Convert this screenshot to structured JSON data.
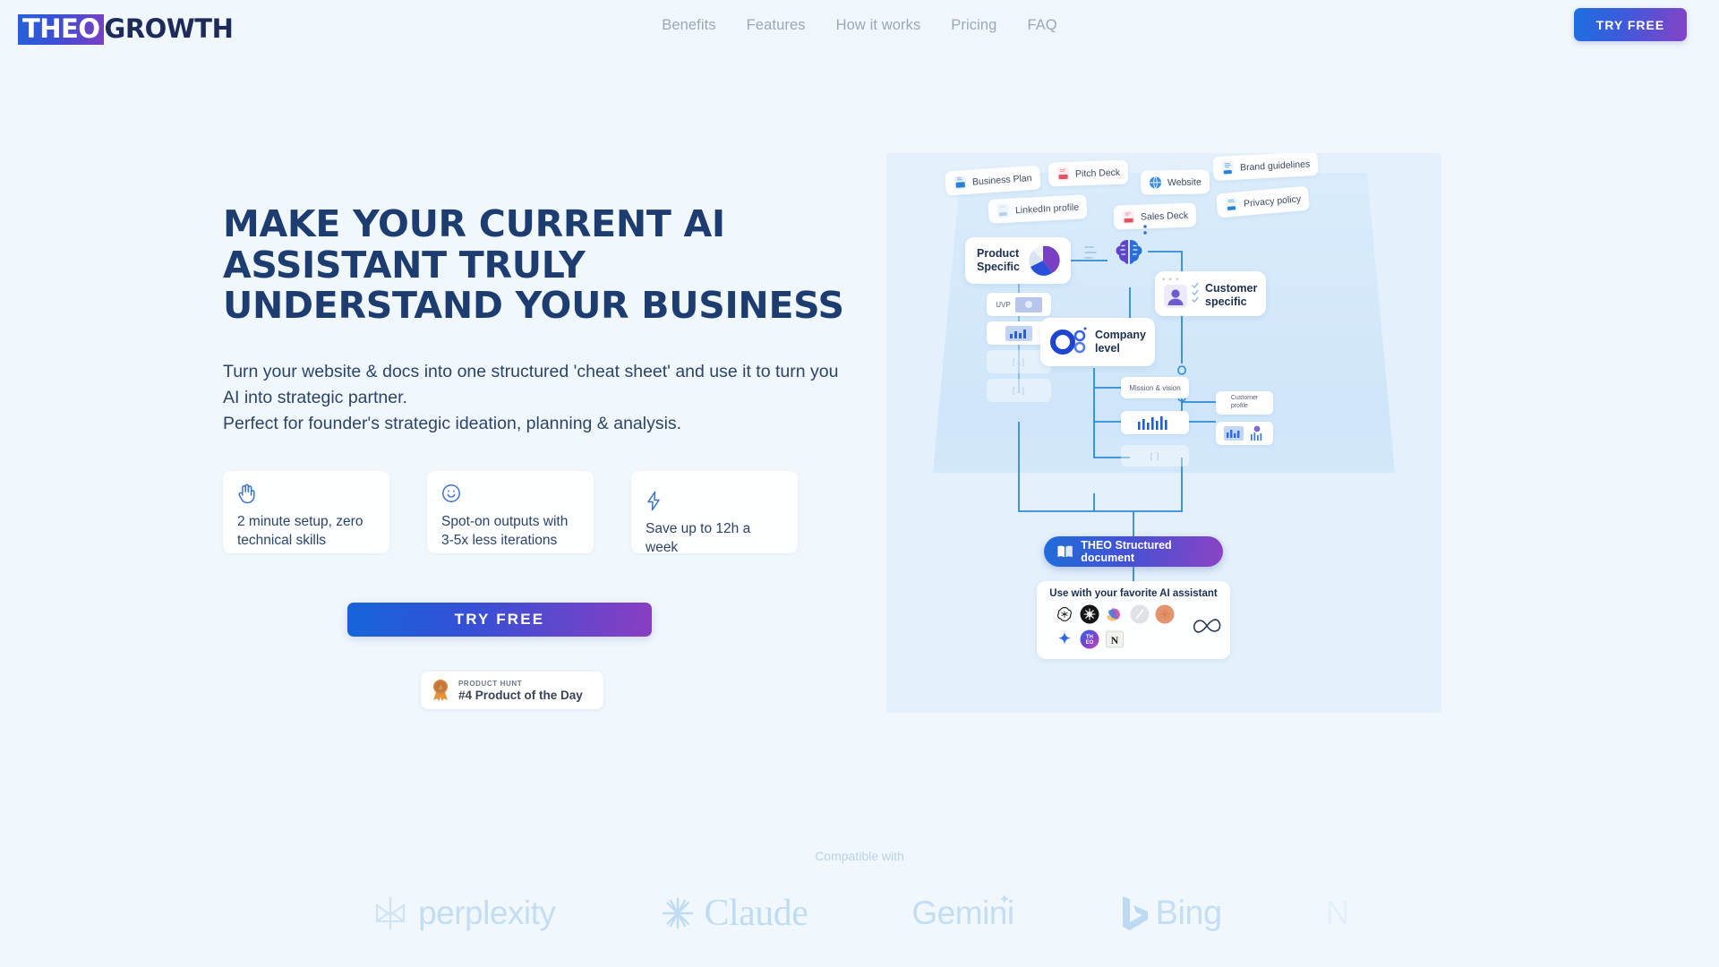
{
  "brand": {
    "logo_primary": "THEO",
    "logo_secondary": "GROWTH",
    "accent_blue": "#1d6fe0",
    "accent_purple": "#8642c6",
    "headline_color": "#1d3c70",
    "page_background": "#f1f8fd",
    "panel_background": "#e4f1fc"
  },
  "header": {
    "nav": [
      {
        "label": "Benefits"
      },
      {
        "label": "Features"
      },
      {
        "label": "How it works"
      },
      {
        "label": "Pricing"
      },
      {
        "label": "FAQ"
      }
    ],
    "cta_label": "TRY FREE"
  },
  "hero": {
    "headline": "Make your current AI assistant truly understand your business",
    "subtext_line1": "Turn your website & docs into one structured 'cheat sheet' and use it to turn you AI into strategic partner.",
    "subtext_line2": "Perfect for founder's strategic ideation, planning & analysis.",
    "cta_label": "TRY FREE",
    "feature_cards": [
      {
        "icon": "hand-wave-icon",
        "text": "2 minute setup, zero technical skills"
      },
      {
        "icon": "smiley-face-icon",
        "text": "Spot-on outputs with 3-5x less iterations"
      },
      {
        "icon": "lightning-bolt-icon",
        "text": "Save up to 12h a week"
      }
    ],
    "product_hunt": {
      "icon": "medal-ribbon-icon",
      "eyebrow": "PRODUCT HUNT",
      "title": "#4 Product of the Day"
    }
  },
  "diagram": {
    "source_documents": [
      {
        "label": "Business Plan",
        "icon": "doc-blue-icon"
      },
      {
        "label": "Pitch Deck",
        "icon": "doc-red-icon"
      },
      {
        "label": "Website",
        "icon": "globe-icon"
      },
      {
        "label": "Brand guidelines",
        "icon": "doc-blue-icon"
      },
      {
        "label": "LinkedIn profile",
        "icon": "doc-faded-icon"
      },
      {
        "label": "Sales Deck",
        "icon": "doc-red-icon"
      },
      {
        "label": "Privacy policy",
        "icon": "doc-blue-icon"
      }
    ],
    "nodes": [
      {
        "label": "Product Specific",
        "icon": "pie-chart-icon"
      },
      {
        "label": "Company level",
        "icon": "donut-chart-icon"
      },
      {
        "label": "Customer specific",
        "icon": "person-avatar-icon"
      }
    ],
    "center_icon": "brain-icon",
    "product_children": [
      {
        "label": "UVP",
        "icon": "image-placeholder-icon"
      },
      {
        "label": "",
        "icon": "bar-chart-icon"
      },
      {
        "label": "[..]",
        "icon": ""
      },
      {
        "label": "[..]",
        "icon": ""
      }
    ],
    "company_children": [
      {
        "label": "Mission & vision",
        "icon": ""
      },
      {
        "label": "",
        "icon": "bar-chart-icon"
      },
      {
        "label": "[ ]",
        "icon": ""
      }
    ],
    "customer_children": [
      {
        "label": "Customer profile",
        "icon": ""
      },
      {
        "label": "",
        "icon": "chart-pair-icon"
      }
    ],
    "output": {
      "label": "THEO Structured document",
      "icon": "open-book-icon"
    },
    "ai_panel": {
      "title": "Use with your favorite AI assistant",
      "assistants": [
        {
          "name": "openai-icon"
        },
        {
          "name": "anthropic-icon"
        },
        {
          "name": "copilot-icon"
        },
        {
          "name": "perplexity-icon"
        },
        {
          "name": "claude-orange-icon"
        },
        {
          "name": "gemini-sparkle-icon"
        },
        {
          "name": "theo-icon"
        },
        {
          "name": "notion-icon"
        },
        {
          "name": "infinity-loop-icon"
        }
      ]
    }
  },
  "compatible": {
    "label": "Compatible with",
    "logos": [
      {
        "name": "perplexity-logo",
        "text": "perplexity"
      },
      {
        "name": "claude-logo",
        "text": "Claude"
      },
      {
        "name": "gemini-logo",
        "text": "Gemini"
      },
      {
        "name": "bing-logo",
        "text": "Bing"
      }
    ]
  }
}
